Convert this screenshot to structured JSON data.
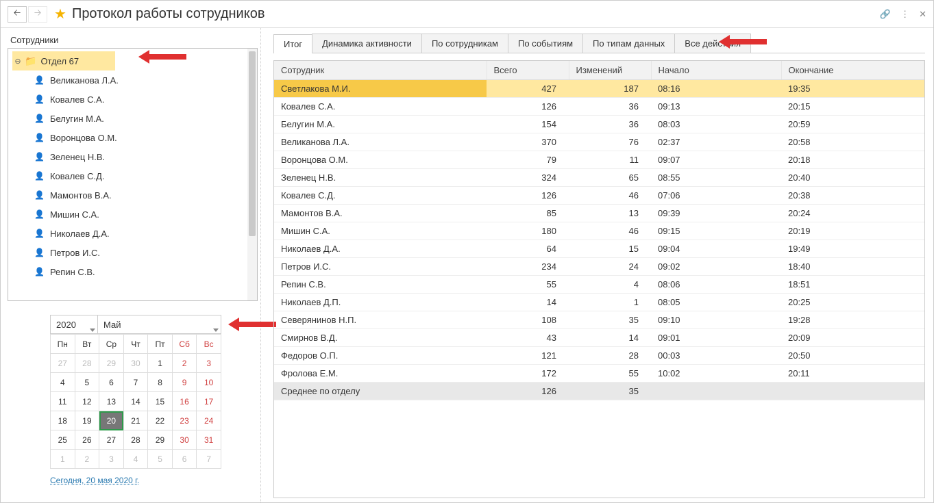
{
  "header": {
    "title": "Протокол работы сотрудников"
  },
  "sidebar": {
    "label": "Сотрудники",
    "department": "Отдел 67",
    "employees": [
      "Великанова Л.А.",
      "Ковалев С.А.",
      "Белугин М.А.",
      "Воронцова О.М.",
      "Зеленец Н.В.",
      "Ковалев С.Д.",
      "Мамонтов В.А.",
      "Мишин С.А.",
      "Николаев Д.А.",
      "Петров И.С.",
      "Репин С.В."
    ]
  },
  "calendar": {
    "year": "2020",
    "month": "Май",
    "weekdays": [
      "Пн",
      "Вт",
      "Ср",
      "Чт",
      "Пт",
      "Сб",
      "Вс"
    ],
    "rows": [
      [
        {
          "d": "27",
          "o": true
        },
        {
          "d": "28",
          "o": true
        },
        {
          "d": "29",
          "o": true
        },
        {
          "d": "30",
          "o": true
        },
        {
          "d": "1"
        },
        {
          "d": "2",
          "w": true
        },
        {
          "d": "3",
          "w": true
        }
      ],
      [
        {
          "d": "4"
        },
        {
          "d": "5"
        },
        {
          "d": "6"
        },
        {
          "d": "7"
        },
        {
          "d": "8"
        },
        {
          "d": "9",
          "w": true
        },
        {
          "d": "10",
          "w": true
        }
      ],
      [
        {
          "d": "11"
        },
        {
          "d": "12"
        },
        {
          "d": "13"
        },
        {
          "d": "14"
        },
        {
          "d": "15"
        },
        {
          "d": "16",
          "w": true
        },
        {
          "d": "17",
          "w": true
        }
      ],
      [
        {
          "d": "18"
        },
        {
          "d": "19"
        },
        {
          "d": "20",
          "sel": true
        },
        {
          "d": "21"
        },
        {
          "d": "22"
        },
        {
          "d": "23",
          "w": true
        },
        {
          "d": "24",
          "w": true
        }
      ],
      [
        {
          "d": "25"
        },
        {
          "d": "26"
        },
        {
          "d": "27"
        },
        {
          "d": "28"
        },
        {
          "d": "29"
        },
        {
          "d": "30",
          "w": true
        },
        {
          "d": "31",
          "w": true
        }
      ],
      [
        {
          "d": "1",
          "o": true
        },
        {
          "d": "2",
          "o": true
        },
        {
          "d": "3",
          "o": true
        },
        {
          "d": "4",
          "o": true
        },
        {
          "d": "5",
          "o": true
        },
        {
          "d": "6",
          "o": true
        },
        {
          "d": "7",
          "o": true
        }
      ]
    ],
    "today_link": "Сегодня, 20 мая 2020 г."
  },
  "tabs": [
    "Итог",
    "Динамика активности",
    "По сотрудникам",
    "По событиям",
    "По типам данных",
    "Все действия"
  ],
  "table": {
    "headers": {
      "employee": "Сотрудник",
      "total": "Всего",
      "changes": "Изменений",
      "start": "Начало",
      "end": "Окончание"
    },
    "rows": [
      {
        "name": "Светлакова М.И.",
        "total": "427",
        "changes": "187",
        "start": "08:16",
        "end": "19:35",
        "hl": true
      },
      {
        "name": "Ковалев С.А.",
        "total": "126",
        "changes": "36",
        "start": "09:13",
        "end": "20:15"
      },
      {
        "name": "Белугин М.А.",
        "total": "154",
        "changes": "36",
        "start": "08:03",
        "end": "20:59"
      },
      {
        "name": "Великанова Л.А.",
        "total": "370",
        "changes": "76",
        "start": "02:37",
        "end": "20:58"
      },
      {
        "name": "Воронцова О.М.",
        "total": "79",
        "changes": "11",
        "start": "09:07",
        "end": "20:18"
      },
      {
        "name": "Зеленец Н.В.",
        "total": "324",
        "changes": "65",
        "start": "08:55",
        "end": "20:40"
      },
      {
        "name": "Ковалев С.Д.",
        "total": "126",
        "changes": "46",
        "start": "07:06",
        "end": "20:38"
      },
      {
        "name": "Мамонтов В.А.",
        "total": "85",
        "changes": "13",
        "start": "09:39",
        "end": "20:24"
      },
      {
        "name": "Мишин С.А.",
        "total": "180",
        "changes": "46",
        "start": "09:15",
        "end": "20:19"
      },
      {
        "name": "Николаев Д.А.",
        "total": "64",
        "changes": "15",
        "start": "09:04",
        "end": "19:49"
      },
      {
        "name": "Петров И.С.",
        "total": "234",
        "changes": "24",
        "start": "09:02",
        "end": "18:40"
      },
      {
        "name": "Репин С.В.",
        "total": "55",
        "changes": "4",
        "start": "08:06",
        "end": "18:51"
      },
      {
        "name": "Николаев Д.П.",
        "total": "14",
        "changes": "1",
        "start": "08:05",
        "end": "20:25"
      },
      {
        "name": "Северянинов Н.П.",
        "total": "108",
        "changes": "35",
        "start": "09:10",
        "end": "19:28"
      },
      {
        "name": "Смирнов В.Д.",
        "total": "43",
        "changes": "14",
        "start": "09:01",
        "end": "20:09"
      },
      {
        "name": "Федоров О.П.",
        "total": "121",
        "changes": "28",
        "start": "00:03",
        "end": "20:50"
      },
      {
        "name": "Фролова Е.М.",
        "total": "172",
        "changes": "55",
        "start": "10:02",
        "end": "20:11"
      }
    ],
    "summary": {
      "name": "Среднее по отделу",
      "total": "126",
      "changes": "35",
      "start": "",
      "end": ""
    }
  }
}
